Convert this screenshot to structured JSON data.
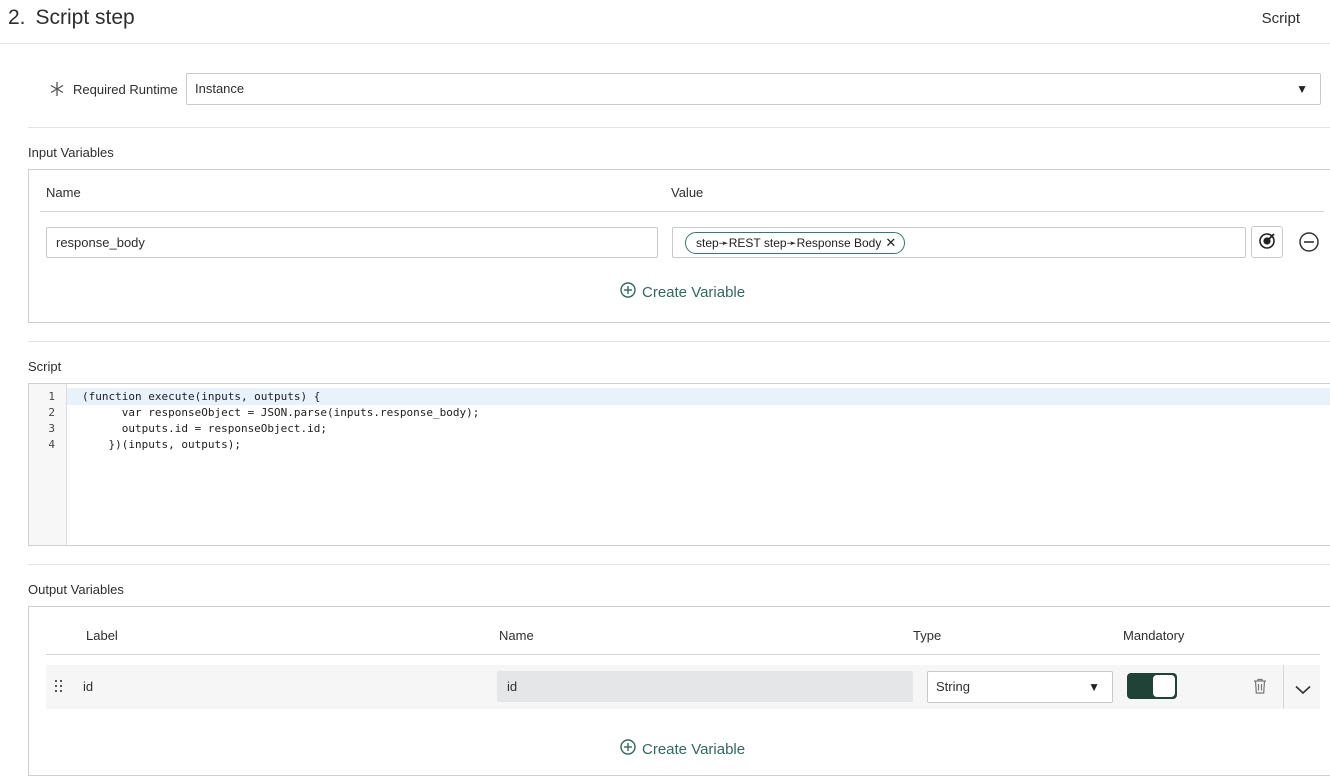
{
  "header": {
    "step_number": "2.",
    "step_title": "Script step",
    "tab_label": "Script"
  },
  "runtime": {
    "label": "Required Runtime",
    "value": "Instance"
  },
  "input_variables": {
    "section_label": "Input Variables",
    "col_name": "Name",
    "col_value": "Value",
    "rows": [
      {
        "name": "response_body",
        "pill": "step➛REST step➛Response Body"
      }
    ],
    "create_label": "Create Variable"
  },
  "script": {
    "section_label": "Script",
    "line_numbers": [
      "1",
      "2",
      "3",
      "4"
    ],
    "lines": [
      "(function execute(inputs, outputs) {",
      "      var responseObject = JSON.parse(inputs.response_body);",
      "      outputs.id = responseObject.id;",
      "    })(inputs, outputs);"
    ]
  },
  "output_variables": {
    "section_label": "Output Variables",
    "col_label": "Label",
    "col_name": "Name",
    "col_type": "Type",
    "col_mandatory": "Mandatory",
    "rows": [
      {
        "label": "id",
        "name": "id",
        "type": "String",
        "mandatory": true
      }
    ],
    "create_label": "Create Variable"
  },
  "icons": {
    "required": "asterisk-icon",
    "dropdown": "caret-down-icon",
    "pill_remove": "close-icon",
    "data_pill_picker": "data-pill-picker-icon",
    "remove_row": "minus-circle-icon",
    "create": "plus-circle-icon",
    "drag": "drag-handle-icon",
    "delete": "trash-icon",
    "expand": "chevron-down-icon"
  },
  "colors": {
    "accent": "#2e6b5e",
    "toggle_on": "#1f4336"
  }
}
